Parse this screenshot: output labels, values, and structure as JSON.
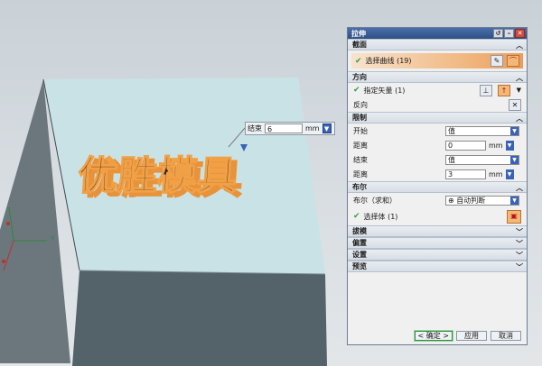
{
  "viewport": {
    "model_text": "优胜模具",
    "axis_label": "Y",
    "float_input": {
      "label": "结束",
      "value": "6",
      "unit": "mm"
    }
  },
  "dialog": {
    "title": "拉伸",
    "titlebar_buttons": [
      "↺",
      "–",
      "✕"
    ],
    "sections": {
      "section": {
        "title": "截面",
        "select_curve_label": "选择曲线 (19)"
      },
      "direction": {
        "title": "方向",
        "specify_vector_label": "指定矢量 (1)",
        "reverse_label": "反向"
      },
      "limits": {
        "title": "限制",
        "start_label": "开始",
        "start_value": "值",
        "start_distance_label": "距离",
        "start_distance_value": "0",
        "end_label": "结束",
        "end_value": "值",
        "end_distance_label": "距离",
        "end_distance_value": "3",
        "unit": "mm"
      },
      "boolean": {
        "title": "布尔",
        "boolean_label": "布尔（求和）",
        "boolean_value": "自动判断",
        "select_body_label": "选择体 (1)"
      },
      "collapsed": [
        "拔模",
        "偏置",
        "设置",
        "预览"
      ]
    },
    "footer": {
      "ok_label": "< 确定 >",
      "apply_label": "应用",
      "cancel_label": "取消"
    }
  },
  "colors": {
    "title_bar": "#2d4f86",
    "highlight": "#f0b57c",
    "check": "#2ea043",
    "model_top": "#c9e2e6",
    "model_side": "#5f6e74"
  }
}
